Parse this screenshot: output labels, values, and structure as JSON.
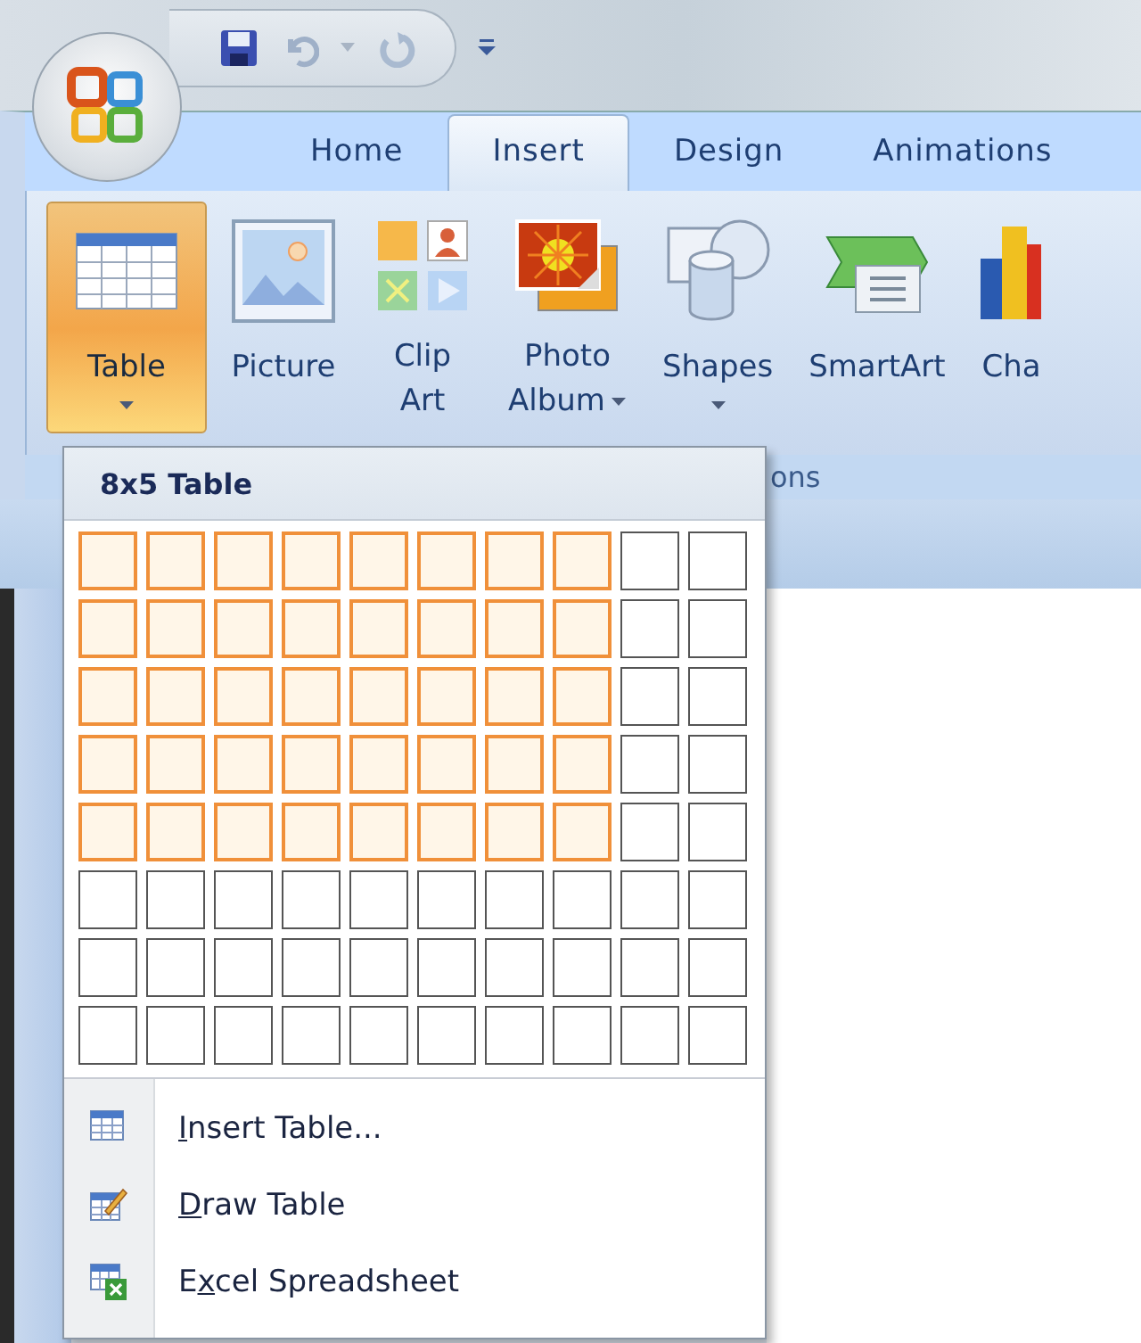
{
  "tabs": [
    {
      "label": "Home",
      "selected": false
    },
    {
      "label": "Insert",
      "selected": true
    },
    {
      "label": "Design",
      "selected": false
    },
    {
      "label": "Animations",
      "selected": false
    }
  ],
  "ribbon": {
    "buttons": [
      {
        "kind": "table",
        "lines": [
          "Table"
        ],
        "dropdown": true,
        "pressed": true
      },
      {
        "kind": "picture",
        "lines": [
          "Picture"
        ],
        "dropdown": false,
        "pressed": false
      },
      {
        "kind": "clipart",
        "lines": [
          "Clip",
          "Art"
        ],
        "dropdown": false,
        "pressed": false
      },
      {
        "kind": "album",
        "lines": [
          "Photo",
          "Album"
        ],
        "dropdown": true,
        "pressed": false
      },
      {
        "kind": "shapes",
        "lines": [
          "Shapes"
        ],
        "dropdown": true,
        "pressed": false
      },
      {
        "kind": "smartart",
        "lines": [
          "SmartArt"
        ],
        "dropdown": false,
        "pressed": false
      },
      {
        "kind": "chart",
        "lines": [
          "Cha"
        ],
        "dropdown": false,
        "pressed": false
      }
    ],
    "group_label": "ons"
  },
  "table_menu": {
    "title": "8x5 Table",
    "grid": [
      [
        {
          "selected": true
        },
        {
          "selected": true
        },
        {
          "selected": true
        },
        {
          "selected": true
        },
        {
          "selected": true
        },
        {
          "selected": true
        },
        {
          "selected": true
        },
        {
          "selected": true
        },
        {
          "selected": false
        },
        {
          "selected": false
        }
      ],
      [
        {
          "selected": true
        },
        {
          "selected": true
        },
        {
          "selected": true
        },
        {
          "selected": true
        },
        {
          "selected": true
        },
        {
          "selected": true
        },
        {
          "selected": true
        },
        {
          "selected": true
        },
        {
          "selected": false
        },
        {
          "selected": false
        }
      ],
      [
        {
          "selected": true
        },
        {
          "selected": true
        },
        {
          "selected": true
        },
        {
          "selected": true
        },
        {
          "selected": true
        },
        {
          "selected": true
        },
        {
          "selected": true
        },
        {
          "selected": true
        },
        {
          "selected": false
        },
        {
          "selected": false
        }
      ],
      [
        {
          "selected": true
        },
        {
          "selected": true
        },
        {
          "selected": true
        },
        {
          "selected": true
        },
        {
          "selected": true
        },
        {
          "selected": true
        },
        {
          "selected": true
        },
        {
          "selected": true
        },
        {
          "selected": false
        },
        {
          "selected": false
        }
      ],
      [
        {
          "selected": true
        },
        {
          "selected": true
        },
        {
          "selected": true
        },
        {
          "selected": true
        },
        {
          "selected": true
        },
        {
          "selected": true
        },
        {
          "selected": true
        },
        {
          "selected": true
        },
        {
          "selected": false
        },
        {
          "selected": false
        }
      ],
      [
        {
          "selected": false
        },
        {
          "selected": false
        },
        {
          "selected": false
        },
        {
          "selected": false
        },
        {
          "selected": false
        },
        {
          "selected": false
        },
        {
          "selected": false
        },
        {
          "selected": false
        },
        {
          "selected": false
        },
        {
          "selected": false
        }
      ],
      [
        {
          "selected": false
        },
        {
          "selected": false
        },
        {
          "selected": false
        },
        {
          "selected": false
        },
        {
          "selected": false
        },
        {
          "selected": false
        },
        {
          "selected": false
        },
        {
          "selected": false
        },
        {
          "selected": false
        },
        {
          "selected": false
        }
      ],
      [
        {
          "selected": false
        },
        {
          "selected": false
        },
        {
          "selected": false
        },
        {
          "selected": false
        },
        {
          "selected": false
        },
        {
          "selected": false
        },
        {
          "selected": false
        },
        {
          "selected": false
        },
        {
          "selected": false
        },
        {
          "selected": false
        }
      ]
    ],
    "items": [
      {
        "kind": "insert",
        "label": {
          "key": "I",
          "after": "nsert Table..."
        }
      },
      {
        "kind": "draw",
        "label": {
          "key": "D",
          "after": "raw Table"
        }
      },
      {
        "kind": "excel",
        "label": {
          "before": "E",
          "key": "x",
          "after": "cel Spreadsheet"
        }
      }
    ]
  }
}
